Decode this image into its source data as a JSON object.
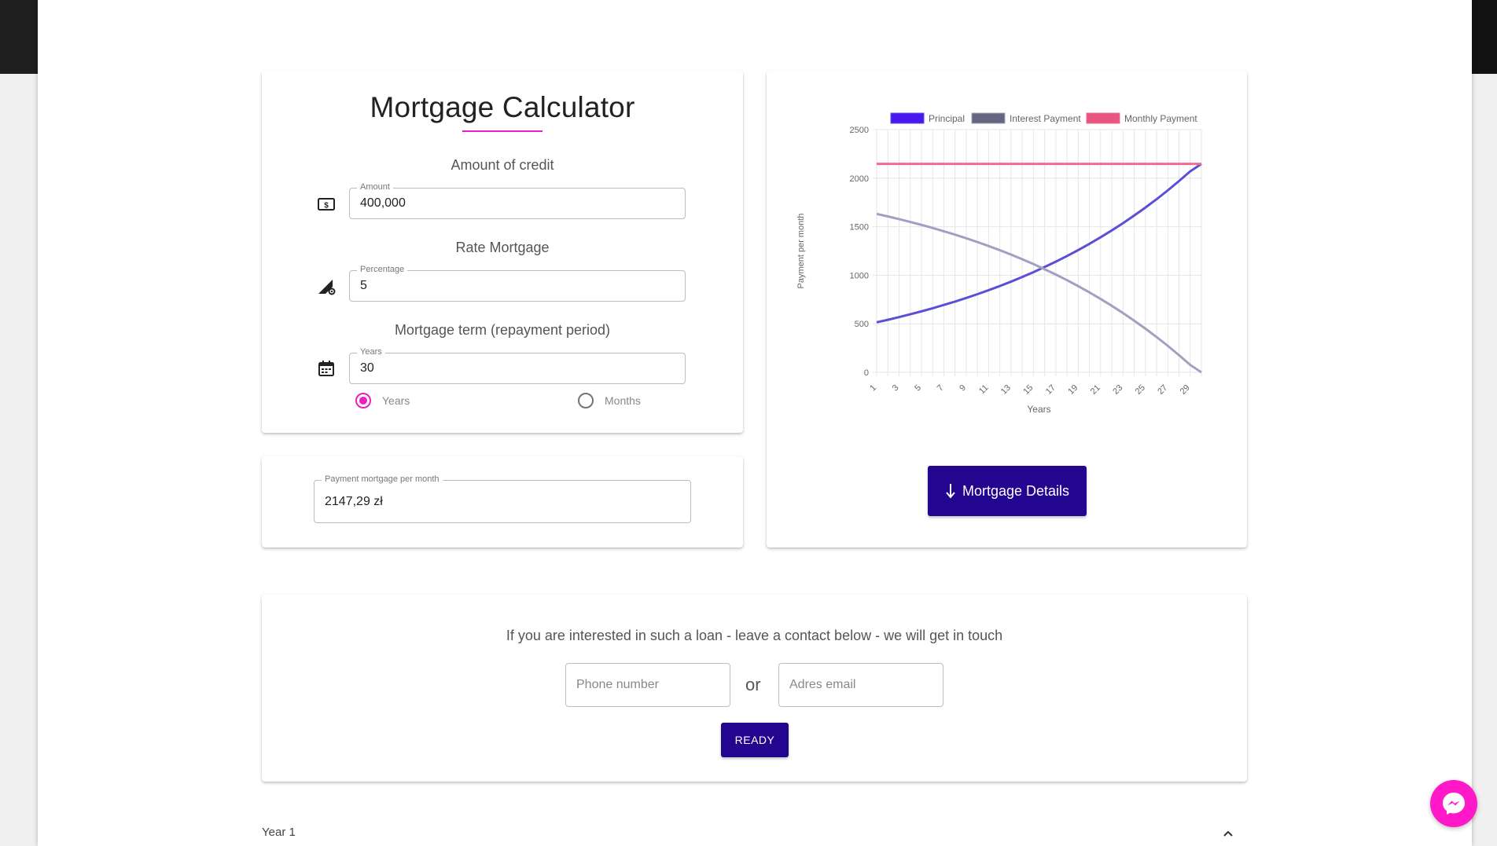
{
  "calculator": {
    "title": "Mortgage Calculator",
    "amount_section": "Amount of credit",
    "amount_legend": "Amount",
    "amount_value": "400,000",
    "rate_section": "Rate Mortgage",
    "rate_legend": "Percentage",
    "rate_value": "5",
    "term_section": "Mortgage term (repayment period)",
    "term_legend": "Years",
    "term_value": "30",
    "radio_years": "Years",
    "radio_months": "Months",
    "selected_unit": "Years",
    "accent_color": "#e91ec4"
  },
  "result": {
    "legend": "Payment mortgage per month",
    "value": "2147,29 zł"
  },
  "details_button": {
    "label": "Mortgage Details",
    "icon": "arrow-down-icon",
    "color": "#23068f"
  },
  "contact": {
    "prompt": "If you are interested in such a loan - leave a contact below - we will get in touch",
    "phone_placeholder": "Phone number",
    "or_text": "or",
    "email_placeholder": "Adres email",
    "ready_label": "READY"
  },
  "accordion": {
    "first_label": "Year 1",
    "icon": "chevron-up-icon"
  },
  "chart_data": {
    "type": "line",
    "xlabel": "Years",
    "ylabel": "Payment per month",
    "ylim": [
      0,
      2500
    ],
    "yticks": [
      0,
      500,
      1000,
      1500,
      2000,
      2500
    ],
    "x": [
      1,
      2,
      3,
      4,
      5,
      6,
      7,
      8,
      9,
      10,
      11,
      12,
      13,
      14,
      15,
      16,
      17,
      18,
      19,
      20,
      21,
      22,
      23,
      24,
      25,
      26,
      27,
      28,
      29,
      30
    ],
    "xtick_labels": [
      "1",
      "3",
      "5",
      "7",
      "9",
      "11",
      "13",
      "15",
      "17",
      "19",
      "21",
      "23",
      "25",
      "27",
      "29"
    ],
    "legend_position": "top",
    "series": [
      {
        "name": "Principal",
        "color": "#5b4fd8",
        "legend_color": "#4b17f0",
        "values": [
          515,
          541,
          569,
          598,
          628,
          660,
          694,
          729,
          766,
          805,
          846,
          889,
          934,
          982,
          1032,
          1085,
          1140,
          1198,
          1259,
          1323,
          1391,
          1462,
          1536,
          1615,
          1697,
          1783,
          1874,
          1970,
          2070,
          2147
        ]
      },
      {
        "name": "Interest Payment",
        "color": "#a39fc2",
        "legend_color": "#65657f",
        "values": [
          1632,
          1606,
          1578,
          1549,
          1519,
          1487,
          1453,
          1418,
          1381,
          1342,
          1301,
          1258,
          1213,
          1165,
          1115,
          1062,
          1007,
          949,
          888,
          824,
          756,
          685,
          611,
          532,
          450,
          364,
          273,
          177,
          77,
          0
        ]
      },
      {
        "name": "Monthly Payment",
        "color": "#f06b8e",
        "legend_color": "#e8567f",
        "values": [
          2147,
          2147,
          2147,
          2147,
          2147,
          2147,
          2147,
          2147,
          2147,
          2147,
          2147,
          2147,
          2147,
          2147,
          2147,
          2147,
          2147,
          2147,
          2147,
          2147,
          2147,
          2147,
          2147,
          2147,
          2147,
          2147,
          2147,
          2147,
          2147,
          2147
        ]
      }
    ],
    "grid": true
  }
}
